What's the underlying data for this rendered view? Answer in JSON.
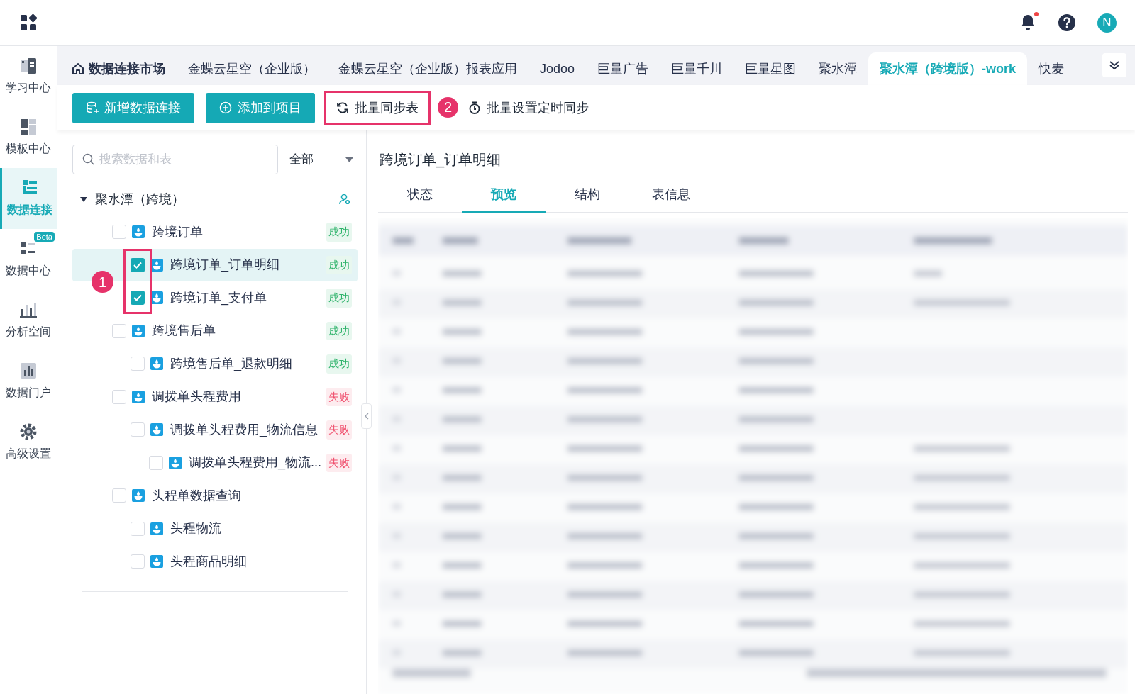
{
  "sidebar": {
    "items": [
      {
        "label": "学习中心",
        "selected": false
      },
      {
        "label": "模板中心",
        "selected": false
      },
      {
        "label": "数据连接",
        "selected": true
      },
      {
        "label": "数据中心",
        "selected": false,
        "badge": "Beta"
      },
      {
        "label": "分析空间",
        "selected": false
      },
      {
        "label": "数据门户",
        "selected": false
      },
      {
        "label": "高级设置",
        "selected": false
      }
    ]
  },
  "header": {
    "avatar": "N",
    "notification": true
  },
  "tabs": [
    {
      "label": "数据连接市场",
      "kind": "home",
      "selected": false
    },
    {
      "label": "金蝶云星空（企业版）",
      "kind": "plain",
      "selected": false
    },
    {
      "label": "金蝶云星空（企业版）报表应用",
      "kind": "plain",
      "selected": false
    },
    {
      "label": "Jodoo",
      "kind": "plain",
      "selected": false
    },
    {
      "label": "巨量广告",
      "kind": "plain",
      "selected": false
    },
    {
      "label": "巨量千川",
      "kind": "plain",
      "selected": false
    },
    {
      "label": "巨量星图",
      "kind": "plain",
      "selected": false
    },
    {
      "label": "聚水潭",
      "kind": "plain",
      "selected": false
    },
    {
      "label": "聚水潭（跨境版）-work",
      "kind": "plain",
      "selected": true
    },
    {
      "label": "快麦",
      "kind": "plain",
      "selected": false
    }
  ],
  "toolbar": [
    {
      "label": "新增数据连接",
      "kind": "primary",
      "highlighted": false
    },
    {
      "label": "添加到项目",
      "kind": "primary",
      "highlighted": false
    },
    {
      "label": "批量同步表",
      "kind": "text",
      "highlighted": true,
      "marker": "2"
    },
    {
      "label": "批量设置定时同步",
      "kind": "text",
      "highlighted": false
    }
  ],
  "search": {
    "placeholder": "搜索数据和表"
  },
  "filter": {
    "value": "全部"
  },
  "tree": {
    "label": "聚水潭（跨境）",
    "expanded": true,
    "marker": "1",
    "children": [
      {
        "label": "跨境订单",
        "checked": false,
        "selected": false,
        "status": {
          "text": "成功",
          "kind": "success"
        },
        "children": [
          {
            "label": "跨境订单_订单明细",
            "checked": true,
            "selected": true,
            "status": {
              "text": "成功",
              "kind": "success"
            }
          },
          {
            "label": "跨境订单_支付单",
            "checked": true,
            "selected": false,
            "status": {
              "text": "成功",
              "kind": "success"
            }
          }
        ]
      },
      {
        "label": "跨境售后单",
        "checked": false,
        "selected": false,
        "status": {
          "text": "成功",
          "kind": "success"
        },
        "children": [
          {
            "label": "跨境售后单_退款明细",
            "checked": false,
            "selected": false,
            "status": {
              "text": "成功",
              "kind": "success"
            }
          }
        ]
      },
      {
        "label": "调拨单头程费用",
        "checked": false,
        "selected": false,
        "status": {
          "text": "失败",
          "kind": "fail"
        },
        "children": [
          {
            "label": "调拨单头程费用_物流信息",
            "checked": false,
            "selected": false,
            "status": {
              "text": "失败",
              "kind": "fail"
            },
            "children": [
              {
                "label": "调拨单头程费用_物流...",
                "checked": false,
                "selected": false,
                "status": {
                  "text": "失败",
                  "kind": "fail"
                }
              }
            ]
          }
        ]
      },
      {
        "label": "头程单数据查询",
        "checked": false,
        "selected": false,
        "children": [
          {
            "label": "头程物流",
            "checked": false,
            "selected": false
          },
          {
            "label": "头程商品明细",
            "checked": false,
            "selected": false
          }
        ]
      }
    ]
  },
  "detail": {
    "title": "跨境订单_订单明细",
    "tabs": [
      {
        "label": "状态",
        "selected": false
      },
      {
        "label": "预览",
        "selected": true
      },
      {
        "label": "结构",
        "selected": false
      },
      {
        "label": "表信息",
        "selected": false
      }
    ]
  }
}
